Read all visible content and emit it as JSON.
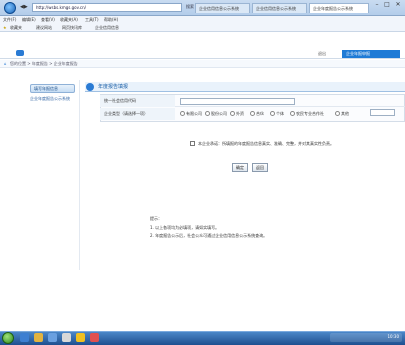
{
  "browser": {
    "address": "http://wsbs.kmgs.gov.cn/",
    "search_hint": "搜索",
    "tabs": [
      "企业信用信息公示系统",
      "企业信用信息公示系统",
      "企业年度报告公示系统"
    ],
    "menu": [
      "文件(F)",
      "编辑(E)",
      "查看(V)",
      "收藏夹(A)",
      "工具(T)",
      "帮助(H)"
    ],
    "favorites": [
      "收藏夹",
      "建议网站",
      "网页快讯库",
      "企业信用信息"
    ]
  },
  "site": {
    "top_right": "企业年报申报",
    "logout": "退出",
    "breadcrumb": "您的位置 > 年度报告 > 企业年度报告"
  },
  "sidebar": {
    "button_label": "填写年报信息",
    "link_label": "企业年度报告公示系统"
  },
  "panel": {
    "title": "年度报告填报"
  },
  "form": {
    "label1": "统一社会信用代码",
    "label2": "企业类型（请选择一项）",
    "radios": [
      "有限公司",
      "股份公司",
      "外资",
      "合伙",
      "个体",
      "农民专业合作社",
      "其他"
    ],
    "confirm_text": "本企业承诺：所填报的年度报告信息真实、准确、完整，并对其真实性负责。",
    "btn_confirm": "确定",
    "btn_back": "返回"
  },
  "notes": {
    "title": "提示：",
    "line1": "1. 以上各项均为必填项，请如实填写。",
    "line2": "2. 年度报告公示后，社会公众可通过企业信用信息公示系统查询。"
  },
  "taskbar": {
    "clock": "10:30"
  }
}
